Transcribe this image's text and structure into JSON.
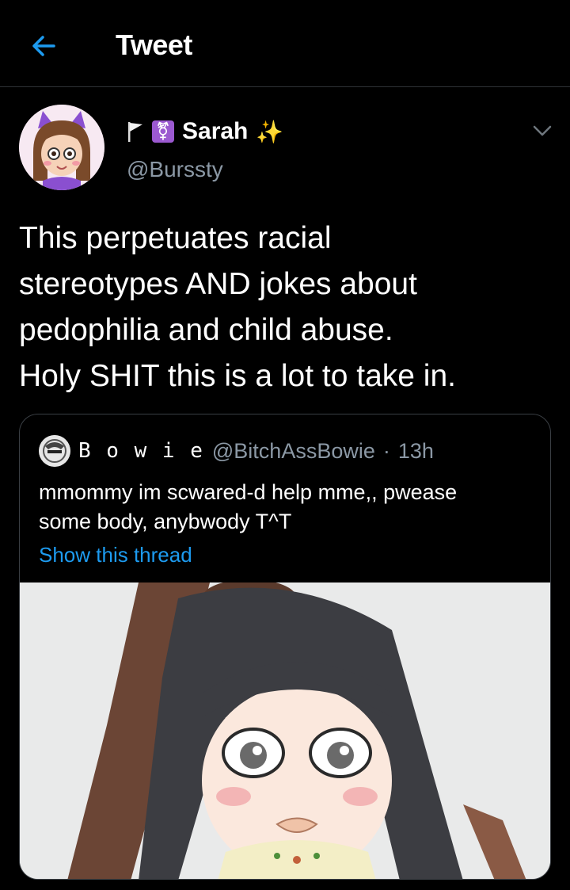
{
  "header": {
    "title": "Tweet",
    "back_icon": "arrow-left-icon",
    "accent": "#1d9bf0"
  },
  "author": {
    "name": "Sarah",
    "handle": "@Burssty",
    "badges": [
      "flag-icon",
      "transgender-symbol-icon",
      "sparkles-icon"
    ],
    "avatar_icon": "cartoon-avatar"
  },
  "tweet": {
    "text": "This perpetuates racial\nstereotypes AND jokes about\npedophilia and child abuse.\nHoly SHIT this is a lot to take in."
  },
  "quote": {
    "name": "B o w i e",
    "handle": "@BitchAssBowie",
    "separator": "·",
    "time": "13h",
    "text": "mmommy im scwared-d help mme,, pwease\nsome body, anybwody T^T",
    "show_thread": "Show this thread",
    "media_icon": "anime-girl-image"
  },
  "colors": {
    "background": "#000000",
    "secondary_text": "#8b98a5",
    "link": "#1d9bf0",
    "border": "#2f3336"
  }
}
